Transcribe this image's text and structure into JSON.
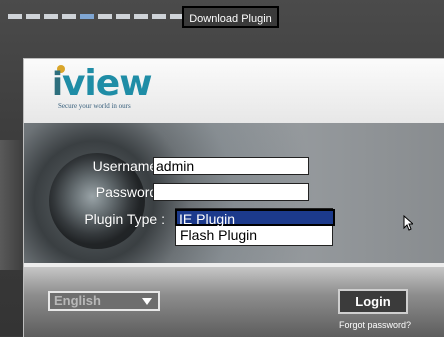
{
  "top_bar": {
    "dot_count": 12,
    "active_dot_index": 4,
    "download_label": "Download Plugin"
  },
  "brand": {
    "logo_text": "view",
    "logo_prefix": "i",
    "tagline": "Secure your world in ours",
    "colors": {
      "logo": "#1f8da6",
      "logo_dot": "#d9a52a"
    }
  },
  "form": {
    "username_label": "Username :",
    "username_value": "admin",
    "password_label": "Password :",
    "password_value": "",
    "plugin_label": "Plugin Type :",
    "plugin_options": [
      "IE Plugin",
      "Flash Plugin"
    ],
    "plugin_selected": "IE Plugin"
  },
  "footer": {
    "language_selected": "English",
    "login_label": "Login",
    "forgot_label": "Forgot password?"
  },
  "colors": {
    "selection_bg": "#1c3a8c",
    "active_dot": "#7fa6d3"
  }
}
